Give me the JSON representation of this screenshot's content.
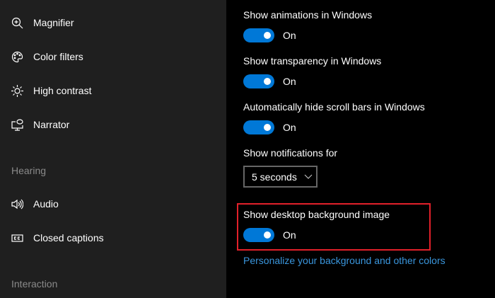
{
  "sidebar": {
    "items": [
      {
        "label": "Magnifier",
        "icon": "magnifier-icon"
      },
      {
        "label": "Color filters",
        "icon": "palette-icon"
      },
      {
        "label": "High contrast",
        "icon": "brightness-icon"
      },
      {
        "label": "Narrator",
        "icon": "narrator-icon"
      }
    ],
    "hearing": {
      "title": "Hearing",
      "items": [
        {
          "label": "Audio",
          "icon": "speaker-icon"
        },
        {
          "label": "Closed captions",
          "icon": "cc-icon"
        }
      ]
    },
    "interaction": {
      "title": "Interaction"
    }
  },
  "main": {
    "settings": [
      {
        "label": "Show animations in Windows",
        "state": "On"
      },
      {
        "label": "Show transparency in Windows",
        "state": "On"
      },
      {
        "label": "Automatically hide scroll bars in Windows",
        "state": "On"
      }
    ],
    "notifications": {
      "label": "Show notifications for",
      "value": "5 seconds"
    },
    "background": {
      "label": "Show desktop background image",
      "state": "On"
    },
    "link": "Personalize your background and other colors",
    "highlight_color": "#e2202a",
    "accent": "#0078d7"
  }
}
